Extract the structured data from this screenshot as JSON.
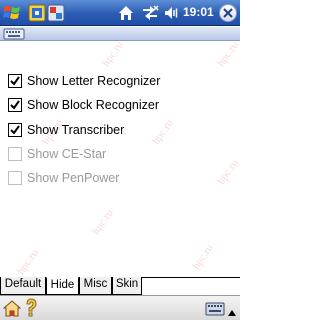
{
  "navbar": {
    "clock": "19:01",
    "icons": [
      "windows-start-icon",
      "app-icon",
      "app-icon",
      "home-icon",
      "connectivity-icon",
      "volume-icon",
      "close-icon"
    ]
  },
  "options": [
    {
      "label": "Show Letter Recognizer",
      "checked": true,
      "enabled": true
    },
    {
      "label": "Show Block Recognizer",
      "checked": true,
      "enabled": true
    },
    {
      "label": "Show Transcriber",
      "checked": true,
      "enabled": true
    },
    {
      "label": "Show CE-Star",
      "checked": false,
      "enabled": false
    },
    {
      "label": "Show PenPower",
      "checked": false,
      "enabled": false
    }
  ],
  "tabs": [
    {
      "label": "Default",
      "active": false
    },
    {
      "label": "Hide",
      "active": true
    },
    {
      "label": "Misc",
      "active": false
    },
    {
      "label": "Skin",
      "active": false
    }
  ],
  "watermark_text": "hpc.ru",
  "colors": {
    "navbar_top": "#5c8fd6",
    "navbar_bottom": "#1f4ea6",
    "disabled_text": "#9a9a9a",
    "watermark": "#f3b8b8"
  }
}
